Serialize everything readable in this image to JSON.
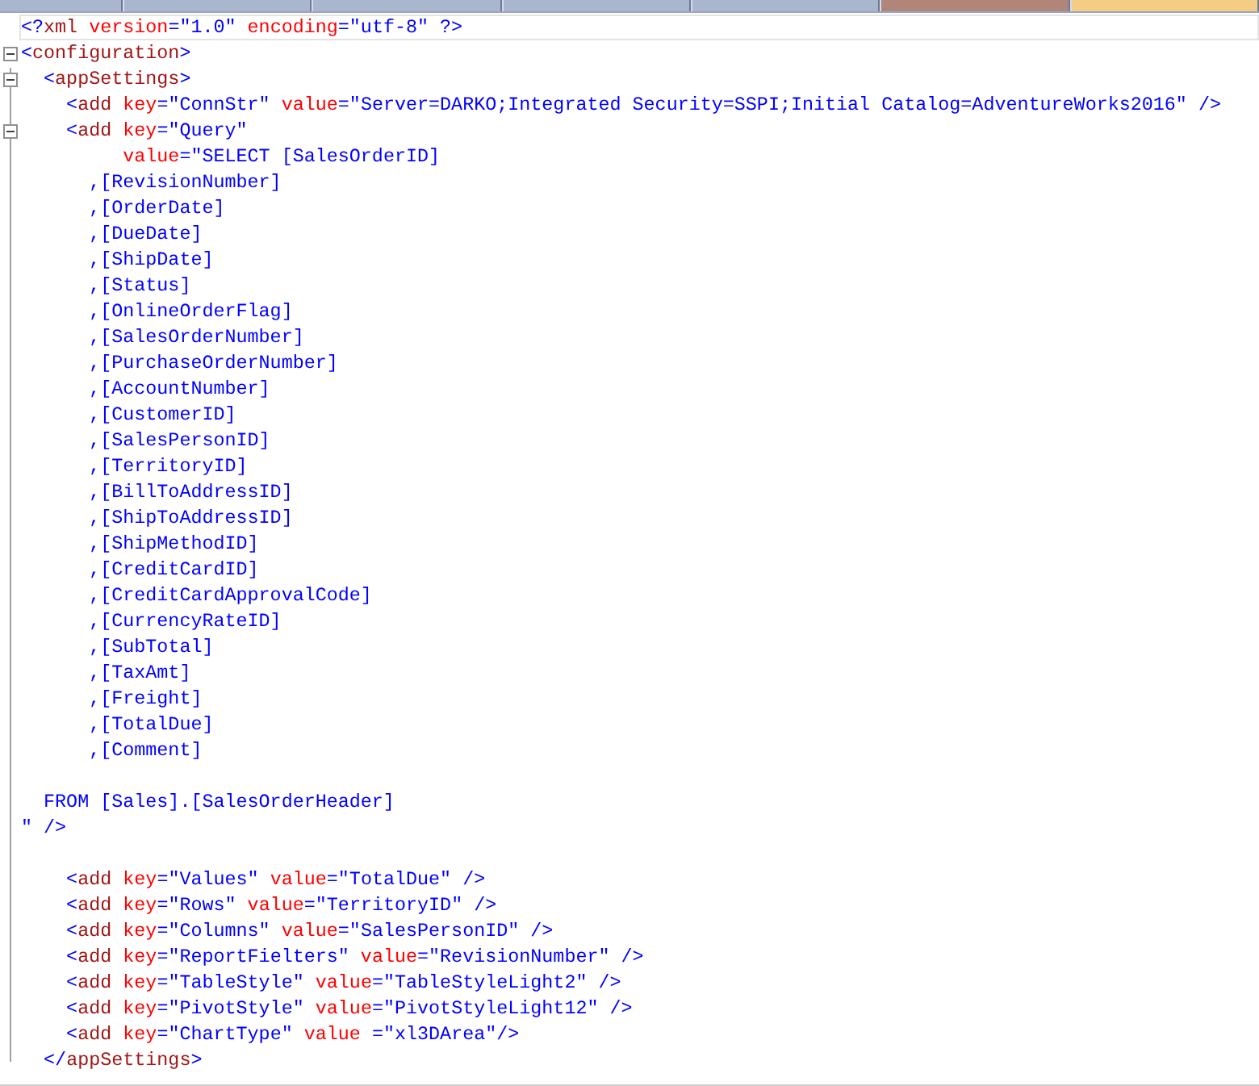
{
  "tabs": [
    {
      "selected": false,
      "hovered": false
    },
    {
      "selected": false,
      "hovered": false
    },
    {
      "selected": false,
      "hovered": false
    },
    {
      "selected": false,
      "hovered": false
    },
    {
      "selected": false,
      "hovered": false
    },
    {
      "selected": false,
      "hovered": true
    },
    {
      "selected": true,
      "hovered": false
    }
  ],
  "editor": {
    "lines": [
      {
        "current": true,
        "fold": false,
        "tokens": [
          {
            "kind": "punct",
            "text": "<?"
          },
          {
            "kind": "tag",
            "text": "xml"
          },
          {
            "kind": "attr",
            "text": " version"
          },
          {
            "kind": "value",
            "text": "=\"1.0\""
          },
          {
            "kind": "attr",
            "text": " encoding"
          },
          {
            "kind": "value",
            "text": "=\"utf-8\""
          },
          {
            "kind": "punct",
            "text": " ?>"
          }
        ]
      },
      {
        "current": false,
        "fold": true,
        "tokens": [
          {
            "kind": "punct",
            "text": "<"
          },
          {
            "kind": "tag",
            "text": "configuration"
          },
          {
            "kind": "punct",
            "text": ">"
          }
        ]
      },
      {
        "current": false,
        "fold": true,
        "tokens": [
          {
            "kind": "punct",
            "text": "  <"
          },
          {
            "kind": "tag",
            "text": "appSettings"
          },
          {
            "kind": "punct",
            "text": ">"
          }
        ]
      },
      {
        "current": false,
        "fold": false,
        "tokens": [
          {
            "kind": "punct",
            "text": "    <"
          },
          {
            "kind": "tag",
            "text": "add"
          },
          {
            "kind": "attr",
            "text": " key"
          },
          {
            "kind": "value",
            "text": "=\"ConnStr\""
          },
          {
            "kind": "attr",
            "text": " value"
          },
          {
            "kind": "value",
            "text": "=\"Server=DARKO;Integrated Security=SSPI;Initial Catalog=AdventureWorks2016\""
          },
          {
            "kind": "punct",
            "text": " />"
          }
        ]
      },
      {
        "current": false,
        "fold": true,
        "tokens": [
          {
            "kind": "punct",
            "text": "    <"
          },
          {
            "kind": "tag",
            "text": "add"
          },
          {
            "kind": "attr",
            "text": " key"
          },
          {
            "kind": "value",
            "text": "=\"Query\""
          }
        ]
      },
      {
        "current": false,
        "fold": false,
        "tokens": [
          {
            "kind": "attr",
            "text": "         value"
          },
          {
            "kind": "value",
            "text": "=\"SELECT [SalesOrderID]"
          }
        ]
      },
      {
        "current": false,
        "fold": false,
        "tokens": [
          {
            "kind": "value",
            "text": "      ,[RevisionNumber]"
          }
        ]
      },
      {
        "current": false,
        "fold": false,
        "tokens": [
          {
            "kind": "value",
            "text": "      ,[OrderDate]"
          }
        ]
      },
      {
        "current": false,
        "fold": false,
        "tokens": [
          {
            "kind": "value",
            "text": "      ,[DueDate]"
          }
        ]
      },
      {
        "current": false,
        "fold": false,
        "tokens": [
          {
            "kind": "value",
            "text": "      ,[ShipDate]"
          }
        ]
      },
      {
        "current": false,
        "fold": false,
        "tokens": [
          {
            "kind": "value",
            "text": "      ,[Status]"
          }
        ]
      },
      {
        "current": false,
        "fold": false,
        "tokens": [
          {
            "kind": "value",
            "text": "      ,[OnlineOrderFlag]"
          }
        ]
      },
      {
        "current": false,
        "fold": false,
        "tokens": [
          {
            "kind": "value",
            "text": "      ,[SalesOrderNumber]"
          }
        ]
      },
      {
        "current": false,
        "fold": false,
        "tokens": [
          {
            "kind": "value",
            "text": "      ,[PurchaseOrderNumber]"
          }
        ]
      },
      {
        "current": false,
        "fold": false,
        "tokens": [
          {
            "kind": "value",
            "text": "      ,[AccountNumber]"
          }
        ]
      },
      {
        "current": false,
        "fold": false,
        "tokens": [
          {
            "kind": "value",
            "text": "      ,[CustomerID]"
          }
        ]
      },
      {
        "current": false,
        "fold": false,
        "tokens": [
          {
            "kind": "value",
            "text": "      ,[SalesPersonID]"
          }
        ]
      },
      {
        "current": false,
        "fold": false,
        "tokens": [
          {
            "kind": "value",
            "text": "      ,[TerritoryID]"
          }
        ]
      },
      {
        "current": false,
        "fold": false,
        "tokens": [
          {
            "kind": "value",
            "text": "      ,[BillToAddressID]"
          }
        ]
      },
      {
        "current": false,
        "fold": false,
        "tokens": [
          {
            "kind": "value",
            "text": "      ,[ShipToAddressID]"
          }
        ]
      },
      {
        "current": false,
        "fold": false,
        "tokens": [
          {
            "kind": "value",
            "text": "      ,[ShipMethodID]"
          }
        ]
      },
      {
        "current": false,
        "fold": false,
        "tokens": [
          {
            "kind": "value",
            "text": "      ,[CreditCardID]"
          }
        ]
      },
      {
        "current": false,
        "fold": false,
        "tokens": [
          {
            "kind": "value",
            "text": "      ,[CreditCardApprovalCode]"
          }
        ]
      },
      {
        "current": false,
        "fold": false,
        "tokens": [
          {
            "kind": "value",
            "text": "      ,[CurrencyRateID]"
          }
        ]
      },
      {
        "current": false,
        "fold": false,
        "tokens": [
          {
            "kind": "value",
            "text": "      ,[SubTotal]"
          }
        ]
      },
      {
        "current": false,
        "fold": false,
        "tokens": [
          {
            "kind": "value",
            "text": "      ,[TaxAmt]"
          }
        ]
      },
      {
        "current": false,
        "fold": false,
        "tokens": [
          {
            "kind": "value",
            "text": "      ,[Freight]"
          }
        ]
      },
      {
        "current": false,
        "fold": false,
        "tokens": [
          {
            "kind": "value",
            "text": "      ,[TotalDue]"
          }
        ]
      },
      {
        "current": false,
        "fold": false,
        "tokens": [
          {
            "kind": "value",
            "text": "      ,[Comment]"
          }
        ]
      },
      {
        "current": false,
        "fold": false
      },
      {
        "current": false,
        "fold": false,
        "tokens": [
          {
            "kind": "value",
            "text": "  FROM [Sales].[SalesOrderHeader]"
          }
        ]
      },
      {
        "current": false,
        "fold": false,
        "tokens": [
          {
            "kind": "value",
            "text": "\""
          },
          {
            "kind": "punct",
            "text": " />"
          }
        ]
      },
      {
        "current": false,
        "fold": false
      },
      {
        "current": false,
        "fold": false,
        "tokens": [
          {
            "kind": "punct",
            "text": "    <"
          },
          {
            "kind": "tag",
            "text": "add"
          },
          {
            "kind": "attr",
            "text": " key"
          },
          {
            "kind": "value",
            "text": "=\"Values\""
          },
          {
            "kind": "attr",
            "text": " value"
          },
          {
            "kind": "value",
            "text": "=\"TotalDue\""
          },
          {
            "kind": "punct",
            "text": " />"
          }
        ]
      },
      {
        "current": false,
        "fold": false,
        "tokens": [
          {
            "kind": "punct",
            "text": "    <"
          },
          {
            "kind": "tag",
            "text": "add"
          },
          {
            "kind": "attr",
            "text": " key"
          },
          {
            "kind": "value",
            "text": "=\"Rows\""
          },
          {
            "kind": "attr",
            "text": " value"
          },
          {
            "kind": "value",
            "text": "=\"TerritoryID\""
          },
          {
            "kind": "punct",
            "text": " />"
          }
        ]
      },
      {
        "current": false,
        "fold": false,
        "tokens": [
          {
            "kind": "punct",
            "text": "    <"
          },
          {
            "kind": "tag",
            "text": "add"
          },
          {
            "kind": "attr",
            "text": " key"
          },
          {
            "kind": "value",
            "text": "=\"Columns\""
          },
          {
            "kind": "attr",
            "text": " value"
          },
          {
            "kind": "value",
            "text": "=\"SalesPersonID\""
          },
          {
            "kind": "punct",
            "text": " />"
          }
        ]
      },
      {
        "current": false,
        "fold": false,
        "tokens": [
          {
            "kind": "punct",
            "text": "    <"
          },
          {
            "kind": "tag",
            "text": "add"
          },
          {
            "kind": "attr",
            "text": " key"
          },
          {
            "kind": "value",
            "text": "=\"ReportFielters\""
          },
          {
            "kind": "attr",
            "text": " value"
          },
          {
            "kind": "value",
            "text": "=\"RevisionNumber\""
          },
          {
            "kind": "punct",
            "text": " />"
          }
        ]
      },
      {
        "current": false,
        "fold": false,
        "tokens": [
          {
            "kind": "punct",
            "text": "    <"
          },
          {
            "kind": "tag",
            "text": "add"
          },
          {
            "kind": "attr",
            "text": " key"
          },
          {
            "kind": "value",
            "text": "=\"TableStyle\""
          },
          {
            "kind": "attr",
            "text": " value"
          },
          {
            "kind": "value",
            "text": "=\"TableStyleLight2\""
          },
          {
            "kind": "punct",
            "text": " />"
          }
        ]
      },
      {
        "current": false,
        "fold": false,
        "tokens": [
          {
            "kind": "punct",
            "text": "    <"
          },
          {
            "kind": "tag",
            "text": "add"
          },
          {
            "kind": "attr",
            "text": " key"
          },
          {
            "kind": "value",
            "text": "=\"PivotStyle\""
          },
          {
            "kind": "attr",
            "text": " value"
          },
          {
            "kind": "value",
            "text": "=\"PivotStyleLight12\""
          },
          {
            "kind": "punct",
            "text": " />"
          }
        ]
      },
      {
        "current": false,
        "fold": false,
        "tokens": [
          {
            "kind": "punct",
            "text": "    <"
          },
          {
            "kind": "tag",
            "text": "add"
          },
          {
            "kind": "attr",
            "text": " key"
          },
          {
            "kind": "value",
            "text": "=\"ChartType\""
          },
          {
            "kind": "attr",
            "text": " value "
          },
          {
            "kind": "value",
            "text": "=\"xl3DArea\""
          },
          {
            "kind": "punct",
            "text": "/>"
          }
        ]
      },
      {
        "current": false,
        "fold": false,
        "tokens": [
          {
            "kind": "punct",
            "text": "  </"
          },
          {
            "kind": "tag",
            "text": "appSettings"
          },
          {
            "kind": "punct",
            "text": ">"
          }
        ]
      }
    ]
  }
}
